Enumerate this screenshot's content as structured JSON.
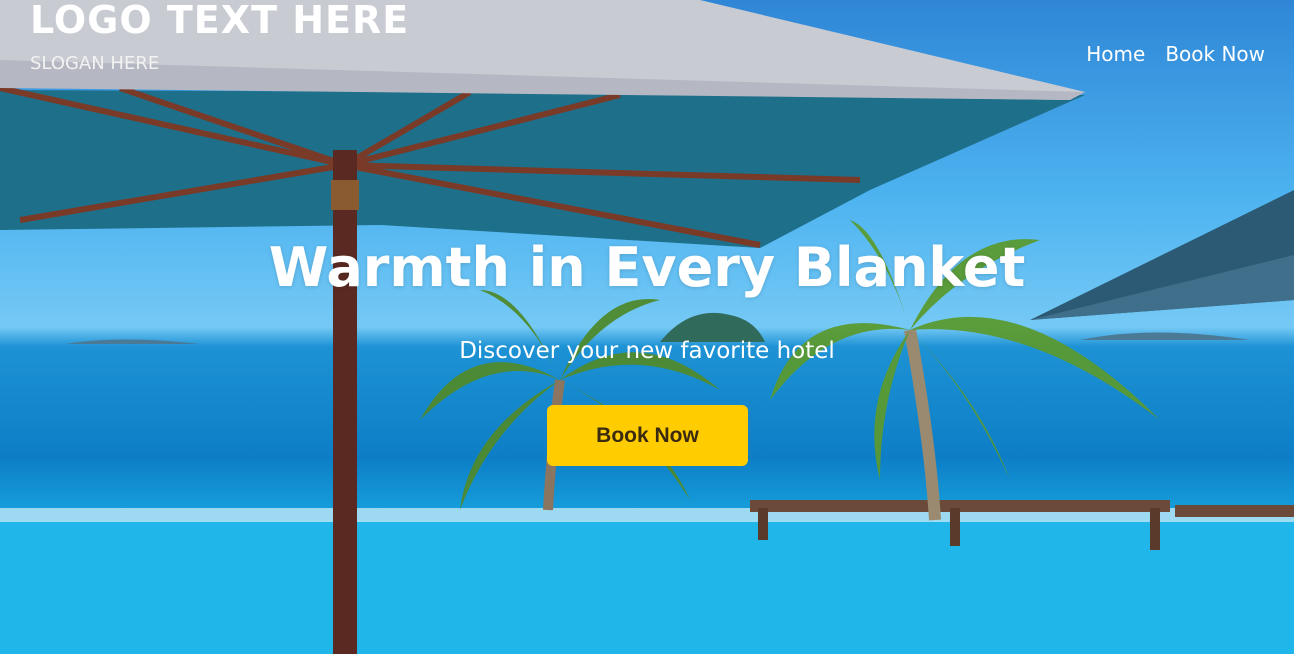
{
  "header": {
    "logo": "LOGO TEXT HERE",
    "slogan": "SLOGAN HERE"
  },
  "nav": {
    "items": [
      {
        "label": "Home"
      },
      {
        "label": "Book Now"
      }
    ]
  },
  "hero": {
    "headline": "Warmth in Every Blanket",
    "subheadline": "Discover your new favorite hotel",
    "cta_label": "Book Now"
  },
  "colors": {
    "cta": "#ffcc00",
    "text": "#ffffff",
    "cta_text": "#3a2a10"
  }
}
